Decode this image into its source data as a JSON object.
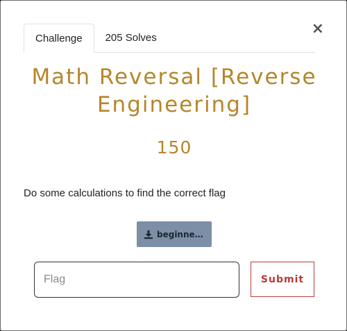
{
  "modal": {
    "close_symbol": "×",
    "tabs": [
      {
        "label": "Challenge",
        "active": true
      },
      {
        "label": "205 Solves",
        "active": false
      }
    ],
    "title": "Math Reversal [Reverse Engineering]",
    "points": "150",
    "description": "Do some calculations to find the correct flag",
    "file": {
      "label": "beginnerR...",
      "icon": "download-icon"
    },
    "flag_input": {
      "placeholder": "Flag",
      "value": ""
    },
    "submit_label": "Submit",
    "colors": {
      "accent": "#b5862a",
      "submit": "#b93a3a",
      "file_button": "#7c8fa6"
    }
  }
}
